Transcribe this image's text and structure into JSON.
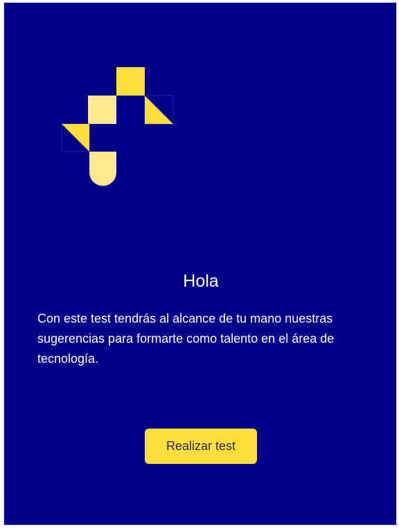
{
  "colors": {
    "background": "#020089",
    "logo_yellow": "#ffdd3a",
    "logo_light_yellow": "#ffe98f",
    "button_bg": "#ffdd3a",
    "button_text": "#2c2a64",
    "text": "#ffffff"
  },
  "logo": {
    "icon": "geometric-pixel-logo-icon"
  },
  "intro": {
    "title": "Hola",
    "description": "Con este test tendrás al alcance de tu mano nuestras sugerencias para formarte como talento en el área de tecnología."
  },
  "actions": {
    "start_label": "Realizar test"
  }
}
